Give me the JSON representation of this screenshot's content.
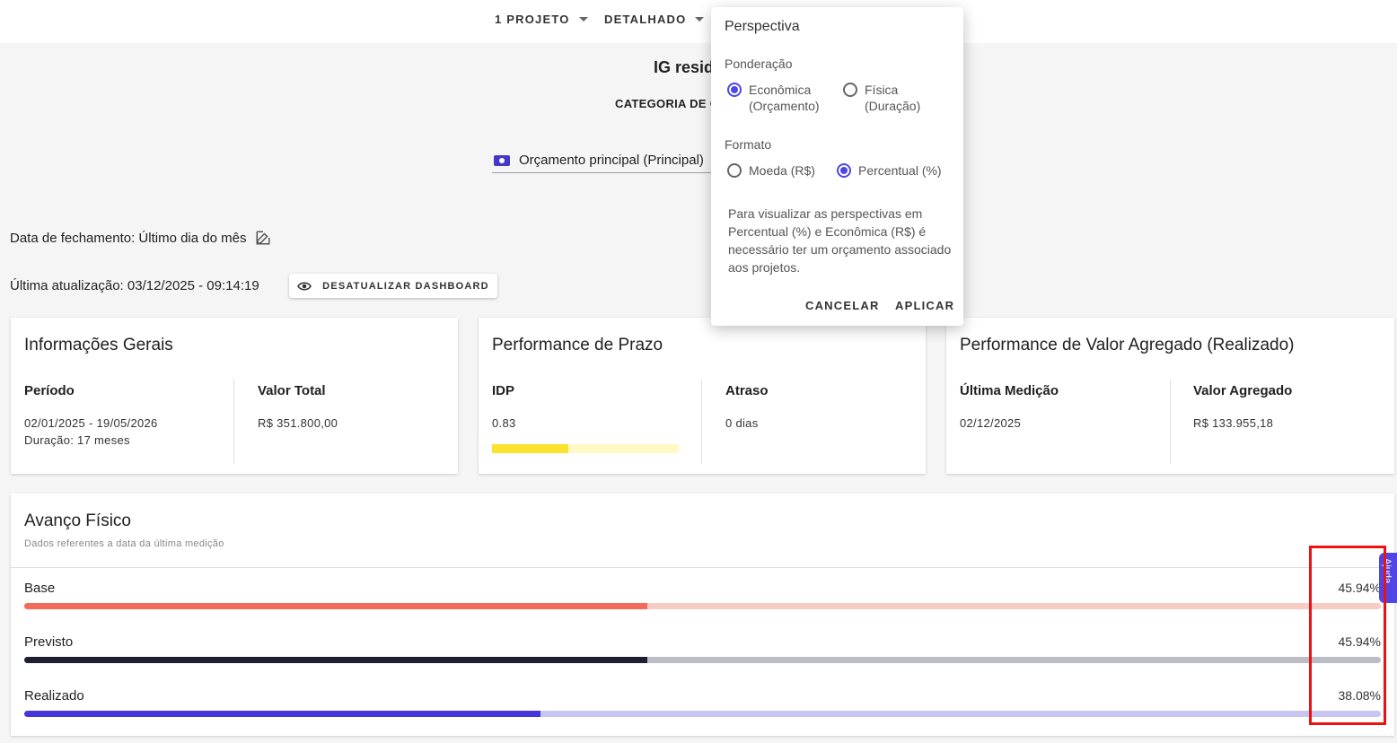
{
  "topbar": {
    "project_selector": "1 PROJETO",
    "view_selector": "DETALHADO"
  },
  "header": {
    "title": "IG resid",
    "category_label": "CATEGORIA DE C"
  },
  "budget": {
    "label": "Orçamento principal (Principal)"
  },
  "closing": {
    "date_text": "Data de fechamento: Último dia do mês"
  },
  "update": {
    "text": "Última atualização: 03/12/2025 - 09:14:19",
    "button": "DESATUALIZAR DASHBOARD"
  },
  "cards": {
    "general": {
      "title": "Informações Gerais",
      "period_label": "Período",
      "period_value": "02/01/2025 - 19/05/2026",
      "duration": "Duração: 17 meses",
      "total_label": "Valor Total",
      "total_value": "R$ 351.800,00"
    },
    "schedule": {
      "title": "Performance de Prazo",
      "idp_label": "IDP",
      "idp_value": "0.83",
      "idp_fraction": 0.41,
      "delay_label": "Atraso",
      "delay_value": "0 dias"
    },
    "earned": {
      "title": "Performance de Valor Agregado (Realizado)",
      "last_label": "Última Medição",
      "last_value": "02/12/2025",
      "ev_label": "Valor Agregado",
      "ev_value": "R$ 133.955,18"
    }
  },
  "progress": {
    "title": "Avanço Físico",
    "subtitle": "Dados referentes a data da última medição",
    "rows": [
      {
        "label": "Base",
        "percent_text": "45.94%",
        "value": 45.94,
        "color": "#f26b5b",
        "track": "#f9cbc5"
      },
      {
        "label": "Previsto",
        "percent_text": "45.94%",
        "value": 45.94,
        "color": "#1f1f33",
        "track": "#bcbcc6"
      },
      {
        "label": "Realizado",
        "percent_text": "38.08%",
        "value": 38.08,
        "color": "#4636d9",
        "track": "#c9c5f2"
      }
    ]
  },
  "help_tab": {
    "label": "Ajuda"
  },
  "popup": {
    "title": "Perspectiva",
    "weighting_label": "Ponderação",
    "weighting_economic": "Econômica\n(Orçamento)",
    "weighting_physical": "Física\n(Duração)",
    "format_label": "Formato",
    "format_currency": "Moeda (R$)",
    "format_percent": "Percentual (%)",
    "note": "Para visualizar as perspectivas em Percentual (%) e Econômica (R$) é necessário ter um orçamento associado aos projetos.",
    "cancel": "CANCELAR",
    "apply": "APLICAR"
  },
  "colors": {
    "accent": "#4f46e5",
    "idp_bar": "#fbe22d",
    "highlight_box": "#ee1111"
  }
}
